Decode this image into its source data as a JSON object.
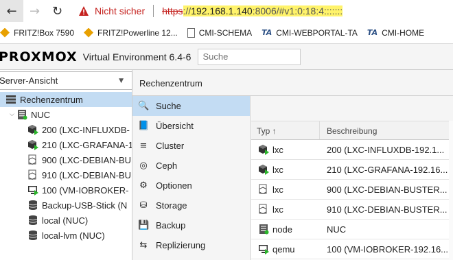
{
  "browser": {
    "security_label": "Nicht sicher",
    "url_scheme": "https",
    "url_sep": "://",
    "url_host": "192.168.1.140",
    "url_rest": ":8006/#v1:0:18:4:::::::"
  },
  "bookmarks": [
    {
      "label": "FRITZ!Box 7590",
      "icon": "fritz-icon"
    },
    {
      "label": "FRITZ!Powerline 12...",
      "icon": "fritz-icon"
    },
    {
      "label": "CMI-SCHEMA",
      "icon": "page-icon"
    },
    {
      "label": "CMI-WEBPORTAL-TA",
      "icon": "tr-icon"
    },
    {
      "label": "CMI-HOME",
      "icon": "tr-icon"
    }
  ],
  "header": {
    "logo_text": "PROXMOX",
    "product": "Virtual Environment 6.4-6",
    "search_placeholder": "Suche"
  },
  "left": {
    "view": "Server-Ansicht",
    "tree": [
      {
        "label": "Rechenzentrum",
        "kind": "datacenter",
        "selected": true
      },
      {
        "label": "NUC",
        "kind": "node"
      },
      {
        "label": "200 (LXC-INFLUXDB-",
        "kind": "lxc-running"
      },
      {
        "label": "210 (LXC-GRAFANA-1",
        "kind": "lxc-running"
      },
      {
        "label": "900 (LXC-DEBIAN-BU",
        "kind": "lxc-template"
      },
      {
        "label": "910 (LXC-DEBIAN-BU",
        "kind": "lxc-template"
      },
      {
        "label": "100 (VM-IOBROKER-",
        "kind": "qemu-running"
      },
      {
        "label": "Backup-USB-Stick (N",
        "kind": "storage"
      },
      {
        "label": "local (NUC)",
        "kind": "storage"
      },
      {
        "label": "local-lvm (NUC)",
        "kind": "storage"
      }
    ]
  },
  "breadcrumb": "Rechenzentrum",
  "menu": [
    {
      "label": "Suche",
      "icon": "search-icon",
      "glyph": "🔍",
      "active": true
    },
    {
      "label": "Übersicht",
      "icon": "book-icon",
      "glyph": "📘"
    },
    {
      "label": "Cluster",
      "icon": "server-icon",
      "glyph": "≡"
    },
    {
      "label": "Ceph",
      "icon": "ceph-icon",
      "glyph": "◎"
    },
    {
      "label": "Optionen",
      "icon": "gear-icon",
      "glyph": "⚙"
    },
    {
      "label": "Storage",
      "icon": "database-icon",
      "glyph": "⛁"
    },
    {
      "label": "Backup",
      "icon": "floppy-icon",
      "glyph": "💾"
    },
    {
      "label": "Replizierung",
      "icon": "retweet-icon",
      "glyph": "⇆"
    }
  ],
  "grid": {
    "col_type": "Typ ↑",
    "col_desc": "Beschreibung",
    "rows": [
      {
        "type": "lxc",
        "desc": "200 (LXC-INFLUXDB-192.1...",
        "kind": "lxc-running"
      },
      {
        "type": "lxc",
        "desc": "210 (LXC-GRAFANA-192.16...",
        "kind": "lxc-running"
      },
      {
        "type": "lxc",
        "desc": "900 (LXC-DEBIAN-BUSTER...",
        "kind": "lxc-template"
      },
      {
        "type": "lxc",
        "desc": "910 (LXC-DEBIAN-BUSTER...",
        "kind": "lxc-template"
      },
      {
        "type": "node",
        "desc": "NUC",
        "kind": "node"
      },
      {
        "type": "qemu",
        "desc": "100 (VM-IOBROKER-192.16...",
        "kind": "qemu-running"
      }
    ]
  },
  "colors": {
    "accent": "#e57000",
    "selected": "#c3dcf3",
    "running": "#2bb52b",
    "warning": "#c5221f"
  }
}
